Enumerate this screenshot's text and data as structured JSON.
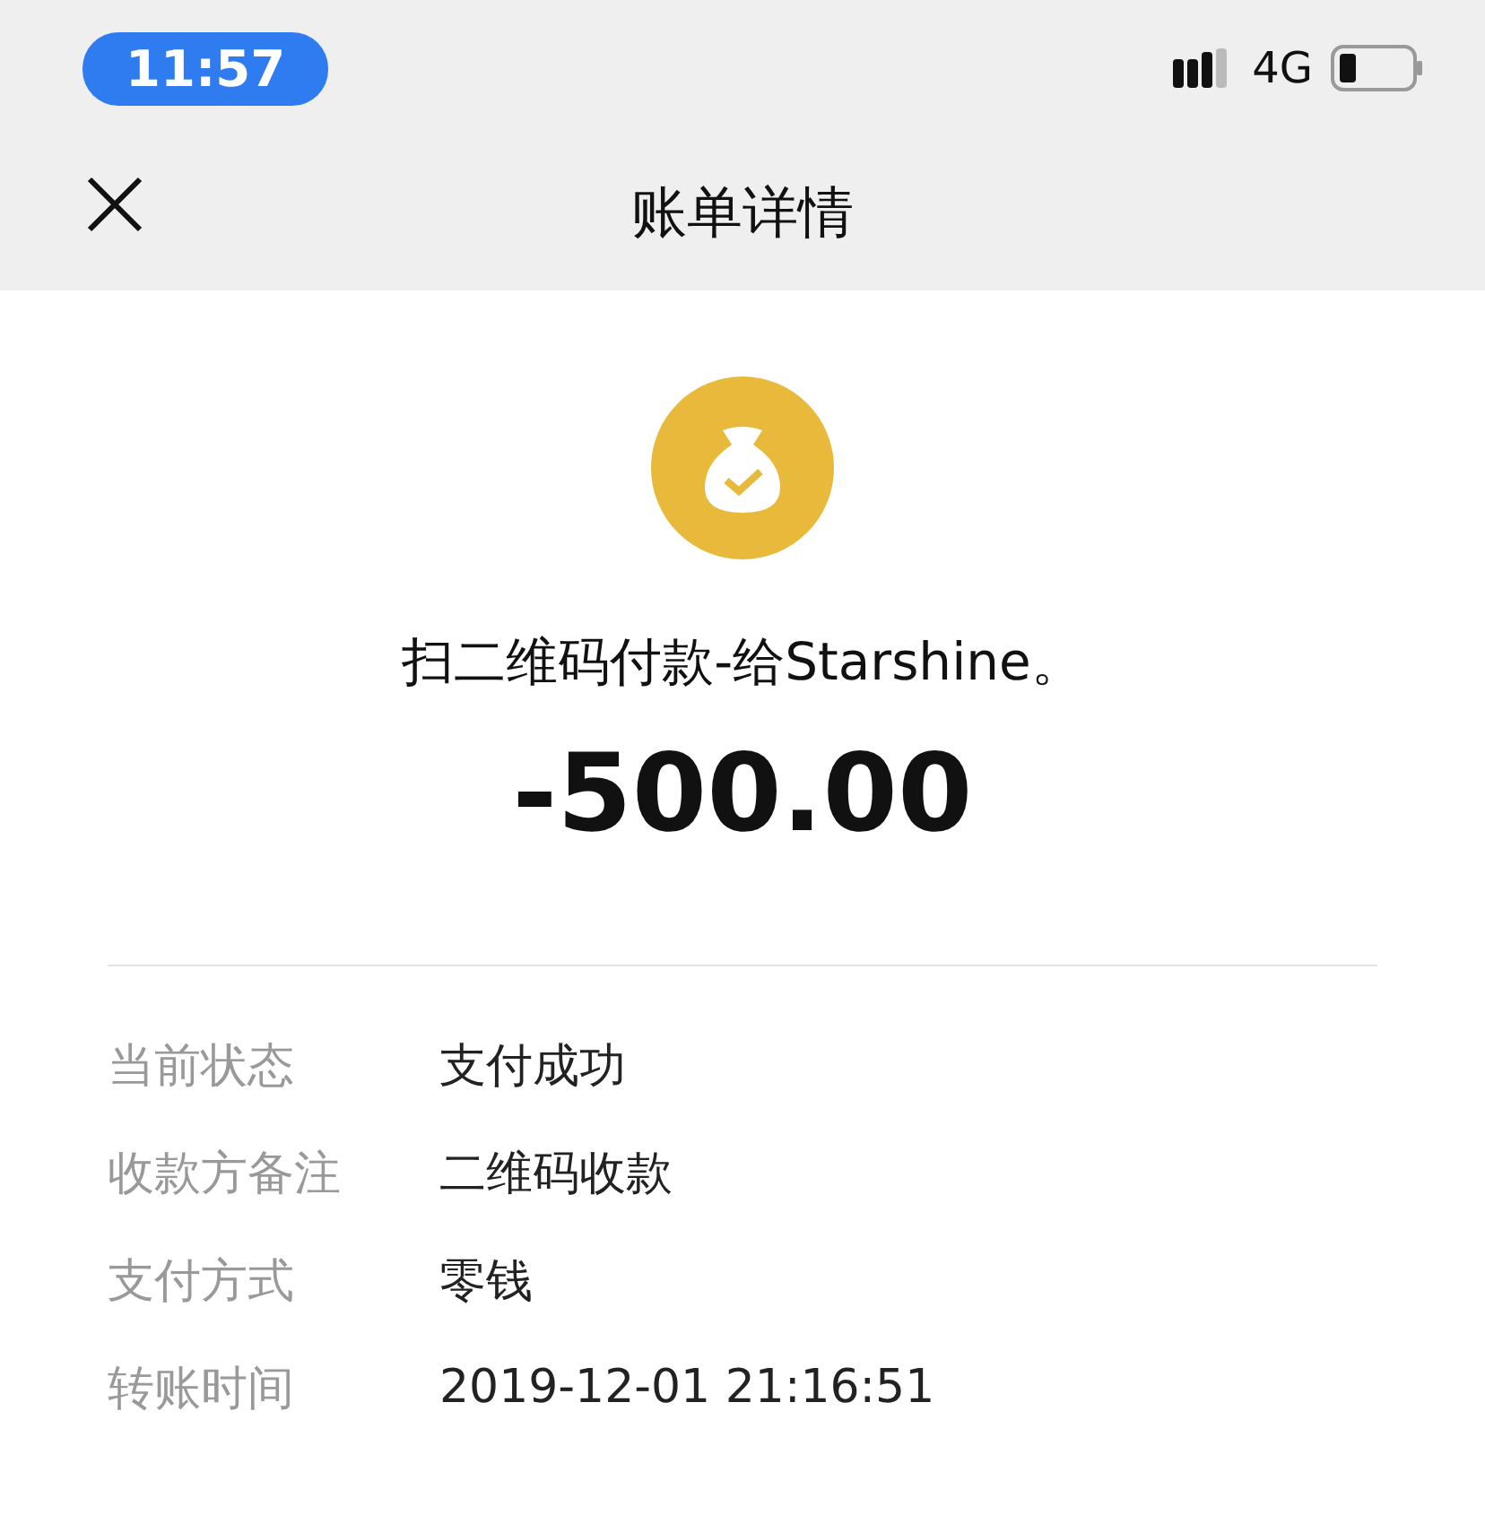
{
  "status_bar": {
    "time": "11:57",
    "network": "4G"
  },
  "nav_bar": {
    "title": "账单详情"
  },
  "payment": {
    "description": "扫二维码付款-给Starshine。",
    "amount": "-500.00"
  },
  "details": [
    {
      "label": "当前状态",
      "value": "支付成功"
    },
    {
      "label": "收款方备注",
      "value": "二维码收款"
    },
    {
      "label": "支付方式",
      "value": "零钱"
    },
    {
      "label": "转账时间",
      "value": "2019-12-01 21:16:51"
    }
  ]
}
